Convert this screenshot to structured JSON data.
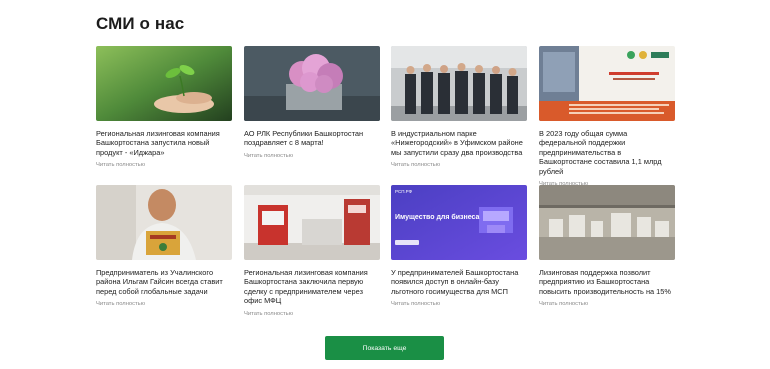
{
  "section": {
    "title": "СМИ о нас"
  },
  "cards": [
    {
      "title": "Региональная лизинговая компания Башкортостана запустила новый продукт - «Иджара»",
      "read_more": "Читать полностью"
    },
    {
      "title": "АО РЛК Республики Башкортостан поздравляет с 8 марта!",
      "read_more": "Читать полностью"
    },
    {
      "title": "В индустриальном парке «Нижегородский» в Уфимском районе мы запустили сразу два производства",
      "read_more": "Читать полностью"
    },
    {
      "title": "В 2023 году общая сумма федеральной поддержки предпринимательства в Башкортостане составила 1,1 млрд рублей",
      "read_more": "Читать полностью"
    },
    {
      "title": "Предприниматель из Учалинского района Ильгам Гайсин всегда ставит перед собой глобальные задачи",
      "read_more": "Читать полностью"
    },
    {
      "title": "Региональная лизинговая компания Башкортостана заключила первую сделку с предпринимателем через офис МФЦ",
      "read_more": "Читать полностью"
    },
    {
      "title": "У предпринимателей Башкортостана появился доступ в онлайн-базу льготного госимущества для МСП",
      "read_more": "Читать полностью"
    },
    {
      "title": "Лизинговая поддержка позволит предприятию из Башкортостана повысить производительность на 15%",
      "read_more": "Читать полностью"
    }
  ],
  "thumb_texts": {
    "card7_heading": "Имущество для бизнеса",
    "card7_logo": "РСП.РФ"
  },
  "actions": {
    "show_more": "Показать еще"
  },
  "colors": {
    "accent": "#1a8f45",
    "text": "#222222",
    "muted": "#8a8a8a"
  }
}
